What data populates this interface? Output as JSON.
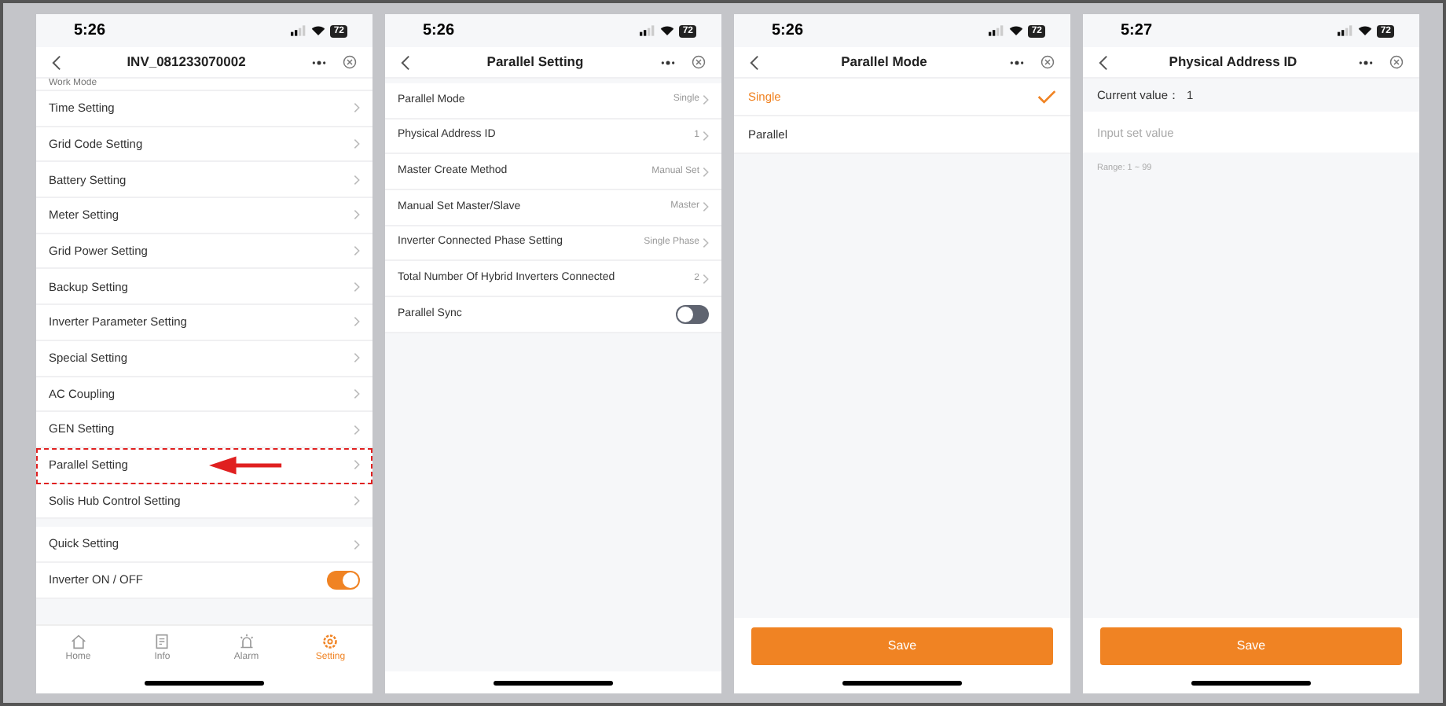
{
  "screens": [
    {
      "kind": "menu",
      "time": "5:26",
      "battery": "72",
      "title": "INV_081233070002",
      "groups": [
        [
          {
            "label": "Work Mode",
            "kind": "partial"
          },
          {
            "label": "Time Setting",
            "kind": "link",
            "highlighted": false
          },
          {
            "label": "Grid Code Setting",
            "kind": "link",
            "highlighted": false
          },
          {
            "label": "Battery Setting",
            "kind": "link",
            "highlighted": false
          },
          {
            "label": "Meter Setting",
            "kind": "link",
            "highlighted": false
          },
          {
            "label": "Grid Power Setting",
            "kind": "link",
            "highlighted": false
          },
          {
            "label": "Backup Setting",
            "kind": "link",
            "highlighted": false
          },
          {
            "label": "Inverter Parameter Setting",
            "kind": "link",
            "highlighted": false
          },
          {
            "label": "Special Setting",
            "kind": "link",
            "highlighted": false
          },
          {
            "label": "AC Coupling",
            "kind": "link",
            "highlighted": false
          },
          {
            "label": "GEN Setting",
            "kind": "link",
            "highlighted": false
          },
          {
            "label": "Parallel Setting",
            "kind": "link",
            "highlighted": true
          },
          {
            "label": "Solis Hub Control Setting",
            "kind": "link",
            "highlighted": false
          }
        ],
        [
          {
            "label": "Quick Setting",
            "kind": "link",
            "highlighted": false
          },
          {
            "label": "Inverter ON / OFF",
            "kind": "toggle",
            "on": true
          }
        ]
      ],
      "tabs": [
        {
          "label": "Home",
          "selected": false
        },
        {
          "label": "Info",
          "selected": false
        },
        {
          "label": "Alarm",
          "selected": false
        },
        {
          "label": "Setting",
          "selected": true
        }
      ]
    },
    {
      "kind": "settings",
      "time": "5:26",
      "battery": "72",
      "title": "Parallel Setting",
      "items": [
        {
          "label": "Parallel Mode",
          "kind": "link",
          "value": "Single"
        },
        {
          "label": "Physical Address ID",
          "kind": "link",
          "value": "1"
        },
        {
          "label": "Master Create Method",
          "kind": "link",
          "value": "Manual Set"
        },
        {
          "label": "Manual Set Master/Slave",
          "kind": "link",
          "value": "Master"
        },
        {
          "label": "Inverter Connected Phase Setting",
          "kind": "link",
          "value": "Single Phase"
        },
        {
          "label": "Total Number Of Hybrid Inverters Connected",
          "kind": "link",
          "value": "2"
        },
        {
          "label": "Parallel Sync",
          "kind": "toggle",
          "on": false
        }
      ]
    },
    {
      "kind": "options",
      "time": "5:26",
      "battery": "72",
      "title": "Parallel Mode",
      "options": [
        {
          "label": "Single",
          "selected": true
        },
        {
          "label": "Parallel",
          "selected": false
        }
      ],
      "button": "Save"
    },
    {
      "kind": "input",
      "time": "5:27",
      "battery": "72",
      "title": "Physical Address ID",
      "current_label": "Current value：",
      "current_value": "1",
      "placeholder": "Input set value",
      "hint": "Range: 1 ~ 99",
      "button": "Save"
    }
  ]
}
